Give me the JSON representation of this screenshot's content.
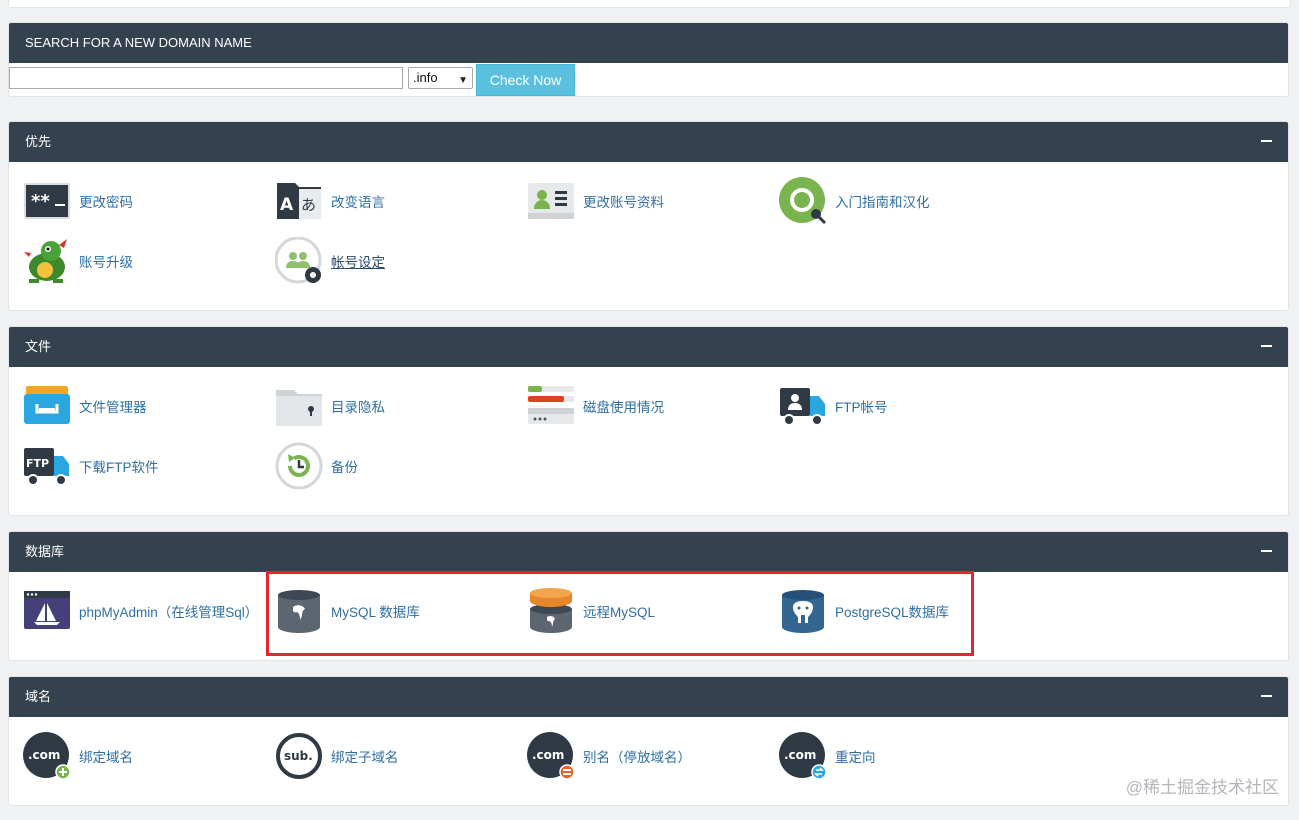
{
  "domain_search": {
    "title": "SEARCH FOR A NEW DOMAIN NAME",
    "input_value": "",
    "tld_selected": ".info",
    "button_label": "Check Now"
  },
  "preferences": {
    "title": "优先",
    "items": [
      {
        "label": "更改密码",
        "icon": "password-icon"
      },
      {
        "label": "改变语言",
        "icon": "language-icon"
      },
      {
        "label": "更改账号资料",
        "icon": "contact-info-icon"
      },
      {
        "label": "入门指南和汉化",
        "icon": "getting-started-icon"
      },
      {
        "label": "账号升级",
        "icon": "dragon-upgrade-icon"
      },
      {
        "label": "帐号设定",
        "icon": "account-settings-icon"
      }
    ]
  },
  "files": {
    "title": "文件",
    "items": [
      {
        "label": "文件管理器",
        "icon": "file-manager-icon"
      },
      {
        "label": "目录隐私",
        "icon": "directory-privacy-icon"
      },
      {
        "label": "磁盘使用情况",
        "icon": "disk-usage-icon"
      },
      {
        "label": "FTP帐号",
        "icon": "ftp-accounts-icon"
      },
      {
        "label": "下载FTP软件",
        "icon": "ftp-download-icon"
      },
      {
        "label": "备份",
        "icon": "backup-icon"
      }
    ]
  },
  "databases": {
    "title": "数据库",
    "items": [
      {
        "label": "phpMyAdmin（在线管理Sql）",
        "icon": "phpmyadmin-icon"
      },
      {
        "label": "MySQL 数据库",
        "icon": "mysql-database-icon"
      },
      {
        "label": "远程MySQL",
        "icon": "remote-mysql-icon"
      },
      {
        "label": "PostgreSQL数据库",
        "icon": "postgresql-database-icon"
      }
    ]
  },
  "domains": {
    "title": "域名",
    "items": [
      {
        "label": "绑定域名",
        "icon": "addon-domain-icon"
      },
      {
        "label": "绑定子域名",
        "icon": "subdomain-icon"
      },
      {
        "label": "别名（停放域名）",
        "icon": "alias-domain-icon"
      },
      {
        "label": "重定向",
        "icon": "redirect-icon"
      }
    ]
  },
  "watermark": "@稀土掘金技术社区",
  "colors": {
    "header_bg": "#34414f",
    "link": "#2f6fa7",
    "button": "#5bc0de",
    "highlight": "#e5262d"
  }
}
